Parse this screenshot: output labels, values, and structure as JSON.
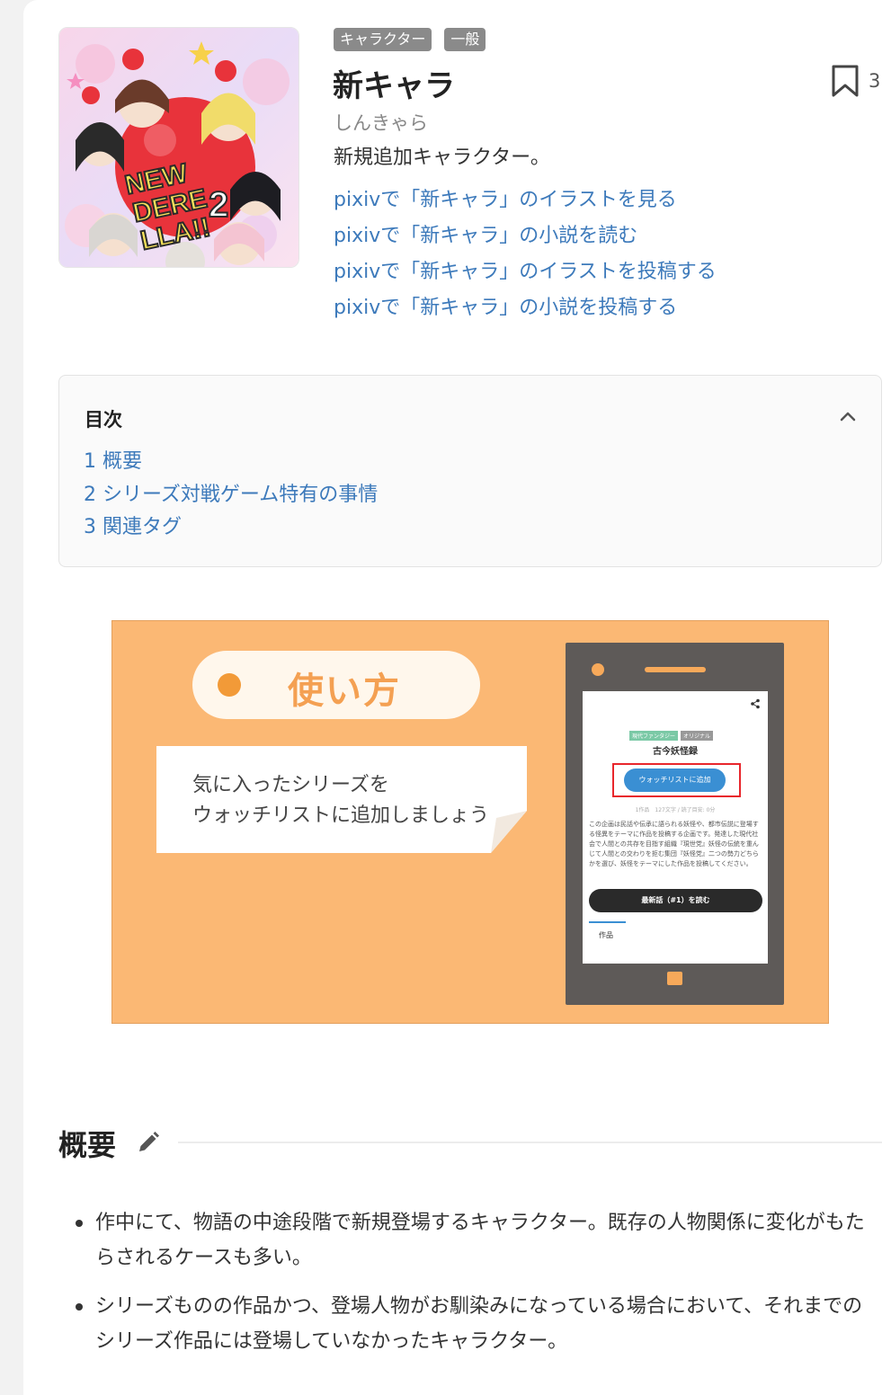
{
  "header": {
    "badges": [
      "キャラクター",
      "一般"
    ],
    "title": "新キャラ",
    "reading": "しんきゃら",
    "description": "新規追加キャラクター。",
    "links": [
      "pixivで「新キャラ」のイラストを見る",
      "pixivで「新キャラ」の小説を読む",
      "pixivで「新キャラ」のイラストを投稿する",
      "pixivで「新キャラ」の小説を投稿する"
    ],
    "bookmark_count": "3",
    "thumbnail_text": "NEW DERE LLA!! 2"
  },
  "toc": {
    "title": "目次",
    "items": [
      "1 概要",
      "2 シリーズ対戦ゲーム特有の事情",
      "3 関連タグ"
    ]
  },
  "banner": {
    "pill_label": "使い方",
    "card_line1": "気に入ったシリーズを",
    "card_line2": "ウォッチリストに追加しましょう",
    "phone": {
      "tag1": "現代ファンタジー",
      "tag2": "オリジナル",
      "title": "古今妖怪録",
      "watch_button": "ウォッチリストに追加",
      "meta": "1作品　127文字 / 読了目安: 0分",
      "body": "この企画は民話や伝承に語られる妖怪や、都市伝説に登場する怪異をテーマに作品を投稿する企画です。発達した現代社会で人間との共存を目指す組織『現世党』妖怪の伝統を重んじて人間との交わりを拒む集団『妖怪党』二つの勢力どちらかを選び、妖怪をテーマにした作品を投稿してください。",
      "read_button": "最新話（#1）を読む",
      "tab": "作品"
    }
  },
  "section": {
    "title": "概要",
    "bullets": [
      "作中にて、物語の中途段階で新規登場するキャラクター。既存の人物関係に変化がもたらされるケースも多い。",
      "シリーズものの作品かつ、登場人物がお馴染みになっている場合において、それまでのシリーズ作品には登場していなかったキャラクター。"
    ]
  },
  "colors": {
    "link": "#3d7abb",
    "banner_bg": "#fbb874",
    "badge_bg": "#8a8a8a"
  }
}
